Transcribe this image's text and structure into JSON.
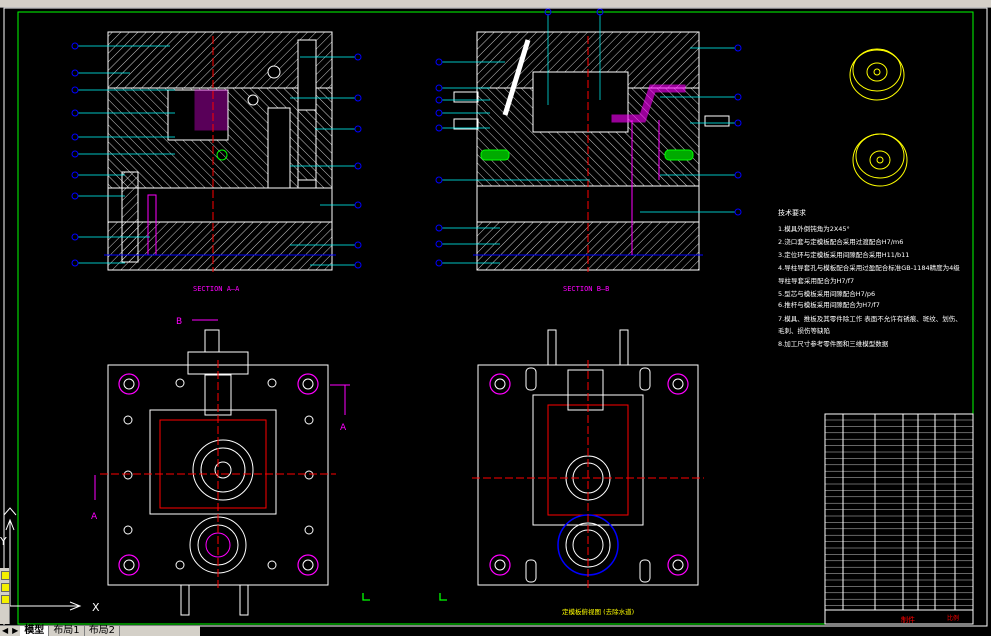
{
  "window": {
    "tabs": [
      {
        "label": "模型",
        "active": true
      },
      {
        "label": "布局1",
        "active": false
      },
      {
        "label": "布局2",
        "active": false
      }
    ]
  },
  "drawing": {
    "section_aa_label": "SECTION A—A",
    "section_bb_label": "SECTION B—B",
    "label_b": "B",
    "label_a": "A",
    "label_a_left": "A",
    "label_a_right": "A",
    "ucs_x": "X",
    "ucs_y": "Y",
    "tech_title": "技术要求",
    "tech_notes": [
      "1.模具外倒钝角为2X45°",
      "2.浇口套与定模板配合采用过渡配合H7/m6",
      "3.定位环与定模板采用间隙配合采用H11/b11",
      "4.导柱导套孔与模板配合采用过盈配合标准GB-1184精度为4级",
      "  导柱导套采用配合为H7/f7",
      "5.型芯与模板采用间隙配合H7/p6",
      "6.推杆与模板采用间隙配合为H7/f7",
      "7.模具、推板及其零件除工作  表面不允许有锈痕、斑纹、划伤、",
      "  毛刺、损伤等缺陷",
      "8.加工尺寸参考零件图和三维模型数据"
    ],
    "bottom_view_caption": "定模板俯视图 (去除水道)",
    "title_block_text_1": "制件",
    "title_block_text_2": "比例"
  },
  "colors": {
    "background": "#000000",
    "white": "#ffffff",
    "cyan": "#00ffff",
    "blue": "#0000ff",
    "magenta": "#ff00ff",
    "red": "#ff0000",
    "green": "#00ff00",
    "yellow": "#ffff00"
  }
}
